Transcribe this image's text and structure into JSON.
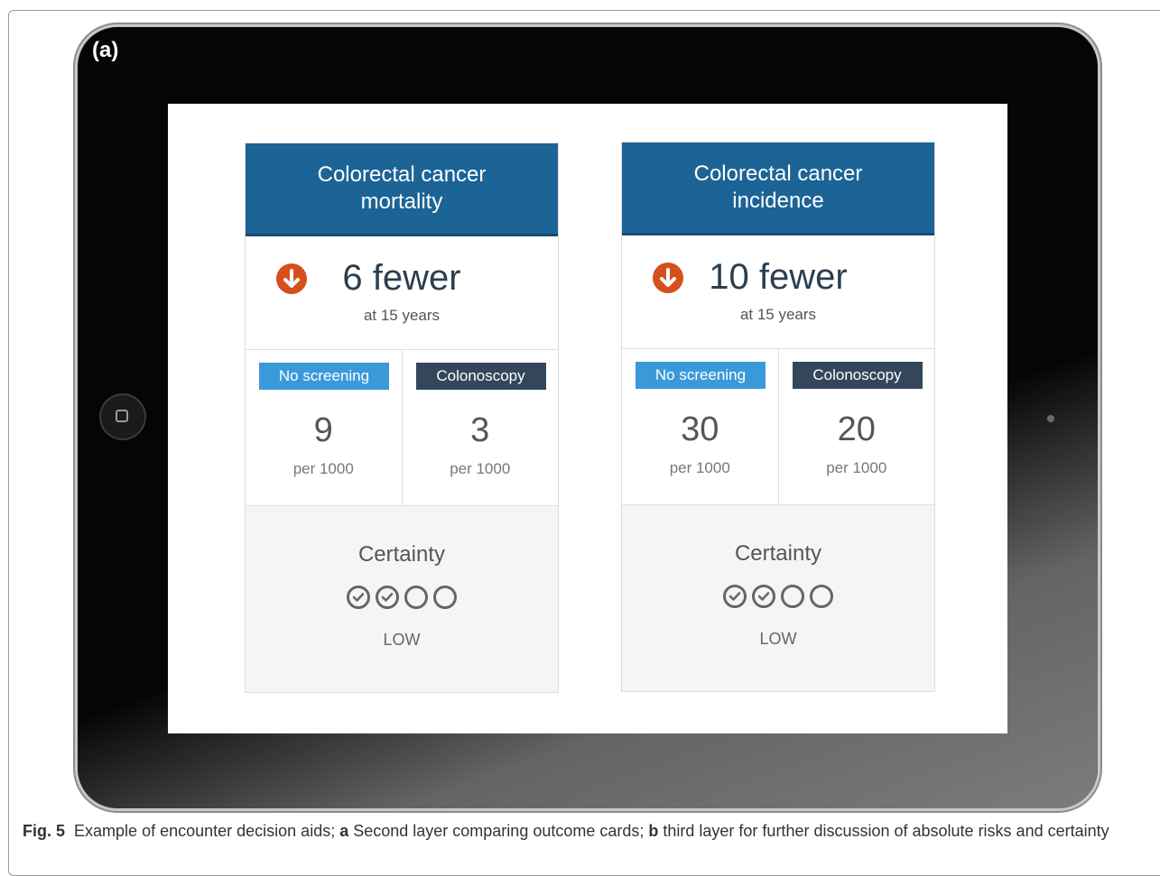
{
  "figure_label": "(a)",
  "cards": [
    {
      "title": "Colorectal cancer mortality",
      "effect": "6 fewer",
      "timeframe": "at 15 years",
      "left_tag": "No screening",
      "left_value": "9",
      "left_unit": "per 1000",
      "right_tag": "Colonoscopy",
      "right_value": "3",
      "right_unit": "per 1000",
      "certainty_title": "Certainty",
      "certainty_level": "LOW",
      "certainty_checked": 2,
      "certainty_total": 4
    },
    {
      "title": "Colorectal cancer incidence",
      "effect": "10 fewer",
      "timeframe": "at 15 years",
      "left_tag": "No screening",
      "left_value": "30",
      "left_unit": "per 1000",
      "right_tag": "Colonoscopy",
      "right_value": "20",
      "right_unit": "per 1000",
      "certainty_title": "Certainty",
      "certainty_level": "LOW",
      "certainty_checked": 2,
      "certainty_total": 4
    }
  ],
  "caption": {
    "fig": "Fig. 5",
    "text1": "Example of encounter decision aids; ",
    "a": "a",
    "text2": " Second layer comparing outcome cards; ",
    "b": "b",
    "text3": " third layer for further discussion of absolute risks and certainty"
  },
  "colors": {
    "header_blue": "#1c6496",
    "tag_blue": "#3a9ad9",
    "tag_dark": "#34475a",
    "down_arrow": "#d6501c"
  }
}
